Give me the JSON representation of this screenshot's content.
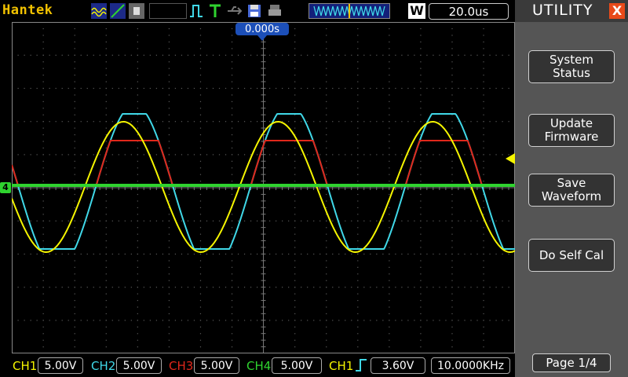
{
  "brand": "Hantek",
  "top": {
    "timebase": "20.0us",
    "trigger_pos_letter": "W",
    "trigger_offset": "0.000s"
  },
  "panel": {
    "title": "UTILITY",
    "close": "X",
    "buttons": [
      {
        "line1": "System",
        "line2": "Status"
      },
      {
        "line1": "Update",
        "line2": "Firmware"
      },
      {
        "line1": "Save",
        "line2": "Waveform"
      },
      {
        "line1": "Do Self Cal",
        "line2": ""
      }
    ],
    "page": "Page 1/4"
  },
  "channels": [
    {
      "label": "CH1",
      "scale": "5.00V",
      "color": "#f5f500"
    },
    {
      "label": "CH2",
      "scale": "5.00V",
      "color": "#40d8e8"
    },
    {
      "label": "CH3",
      "scale": "5.00V",
      "color": "#e0271b"
    },
    {
      "label": "CH4",
      "scale": "5.00V",
      "color": "#2fd32f"
    }
  ],
  "trigger": {
    "source": "CH1",
    "level": "3.60V",
    "frequency": "10.0000KHz"
  },
  "ch4_marker": "4",
  "colors": {
    "bg": "#000000",
    "grid": "#5a5a5a",
    "panel": "#555555",
    "accent_yellow": "#f2c200"
  }
}
